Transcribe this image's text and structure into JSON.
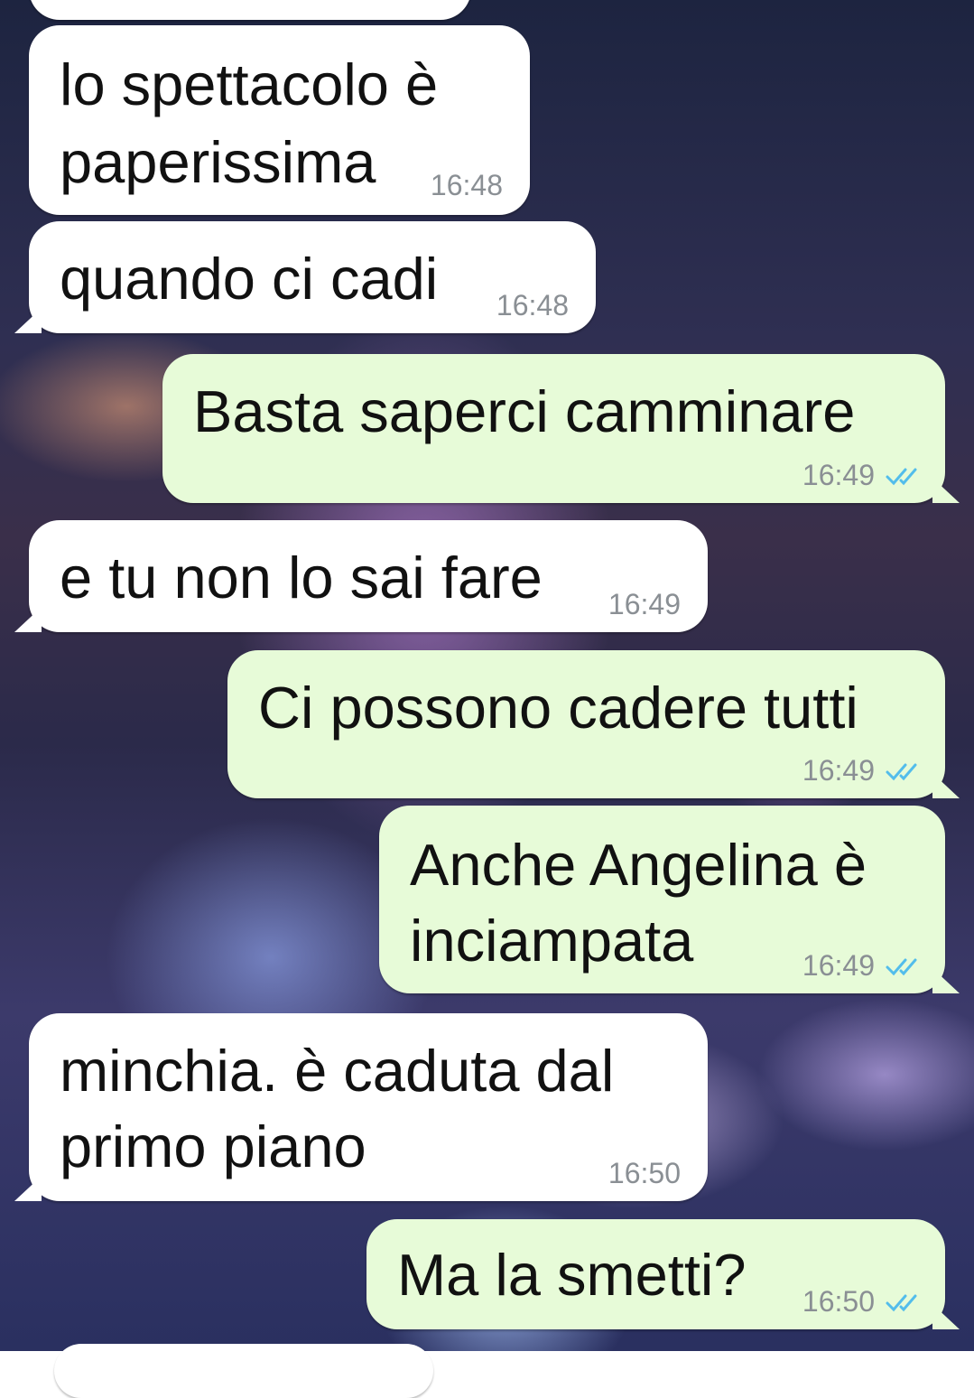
{
  "messages": [
    {
      "dir": "in",
      "lines": [
        "lo spettacolo è",
        "paperissima"
      ],
      "time": "16:48"
    },
    {
      "dir": "in",
      "lines": [
        "quando ci cadi"
      ],
      "time": "16:48"
    },
    {
      "dir": "out",
      "lines": [
        "Basta saperci camminare"
      ],
      "time": "16:49",
      "status": "read-double-check-icon"
    },
    {
      "dir": "in",
      "lines": [
        "e tu non lo sai fare"
      ],
      "time": "16:49"
    },
    {
      "dir": "out",
      "lines": [
        "Ci possono cadere tutti"
      ],
      "time": "16:49",
      "status": "read-double-check-icon"
    },
    {
      "dir": "out",
      "lines": [
        "Anche Angelina è",
        "inciampata"
      ],
      "time": "16:49",
      "status": "read-double-check-icon"
    },
    {
      "dir": "in",
      "lines": [
        "minchia. è caduta dal",
        "primo piano"
      ],
      "time": "16:50"
    },
    {
      "dir": "out",
      "lines": [
        "Ma la smetti?"
      ],
      "time": "16:50",
      "status": "read-double-check-icon"
    }
  ],
  "colors": {
    "incoming_bubble": "#ffffff",
    "outgoing_bubble": "#e7fbd8",
    "read_ticks": "#53bdeb",
    "timestamp": "#8a8f94"
  }
}
